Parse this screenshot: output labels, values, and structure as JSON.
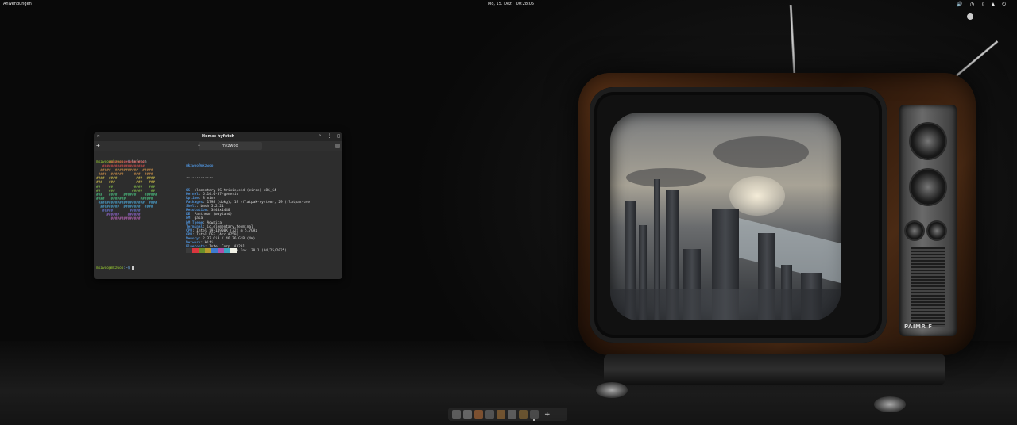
{
  "panel": {
    "applications_label": "Anwendungen",
    "date": "Mo, 15. Dez",
    "time": "00:28:05",
    "tray_icons": [
      "volume-icon",
      "wifi-icon",
      "bluetooth-icon",
      "notifications-icon",
      "power-icon"
    ]
  },
  "terminal": {
    "title": "Home: hyfetch",
    "tab_label": "mkzwoo",
    "prompt_user": "mkzwoo@mkzwoo",
    "prompt_path": ":~$",
    "command": " hyfetch",
    "info_header": "mkzwoo@mkzwoo",
    "separator": "-------------",
    "info": [
      {
        "k": "OS",
        "v": "elementary OS trixie/sid (circe) x86_64"
      },
      {
        "k": "Kernel",
        "v": "6.14.0-37-generic"
      },
      {
        "k": "Uptime",
        "v": "8 mins"
      },
      {
        "k": "Packages",
        "v": "1798 (dpkg), 19 (flatpak-system), 29 (flatpak-use"
      },
      {
        "k": "Shell",
        "v": "bash 5.2.21"
      },
      {
        "k": "Resolution",
        "v": "3440x1440"
      },
      {
        "k": "DE",
        "v": "Pantheon (wayland)"
      },
      {
        "k": "WM",
        "v": "gala"
      },
      {
        "k": "WM Theme",
        "v": "Adwaita"
      },
      {
        "k": "Terminal",
        "v": "io.elementary.terminal"
      },
      {
        "k": "CPU",
        "v": "Intel i9-14900K (32) @ 5.7GHz"
      },
      {
        "k": "GPU",
        "v": "Intel DG2 [Arc A750]"
      },
      {
        "k": "Memory",
        "v": "2.37 GiB / 46.76 GiB (4%)"
      },
      {
        "k": "Network",
        "v": "Wifi"
      },
      {
        "k": "Bluetooth",
        "v": "Intel Corp. AX201"
      },
      {
        "k": "BIOS",
        "v": "American Megatrends Inc. 30.1 (04/25/2025)"
      }
    ],
    "logo_lines": [
      "      #################",
      "   ####################",
      "  #####  ###########  #####",
      " ####  ######     ###  ####",
      "####  ####         ###  ####",
      "###   ###          ###   ###",
      "##    ##          ####   ###",
      "##    ###        #####    ##",
      "###   ####   ######    ######",
      "####   #######       ######",
      " ######################  ####",
      "  #########  ########  ####",
      "   #####        #####",
      "     ######    ######",
      "       ##############"
    ],
    "logo_colors": [
      "#e8534f",
      "#e8534f",
      "#e8a04f",
      "#e8a04f",
      "#e8d34f",
      "#e8d34f",
      "#8fd14f",
      "#8fd14f",
      "#4fd18a",
      "#4fd18a",
      "#4fb3e8",
      "#4fb3e8",
      "#6f7fe8",
      "#a06fe8",
      "#d06fd0"
    ],
    "swatch_colors": [
      "#3b3b3b",
      "#d9363e",
      "#6a8f2a",
      "#b89a2e",
      "#3d7bd0",
      "#b04fa8",
      "#3ba4c0",
      "#f2f2e6"
    ],
    "cursor_prompt": "mkzwoo@mkzwoo"
  },
  "tv": {
    "brand": "PAIMR F"
  },
  "dock": {
    "apps": [
      "#8a8a8a",
      "#9a9a9a",
      "#c4753a",
      "#7a7a7a",
      "#b07a3a",
      "#8a8a8a",
      "#a07a3a",
      "#6a6a6a"
    ],
    "add_label": "+"
  }
}
